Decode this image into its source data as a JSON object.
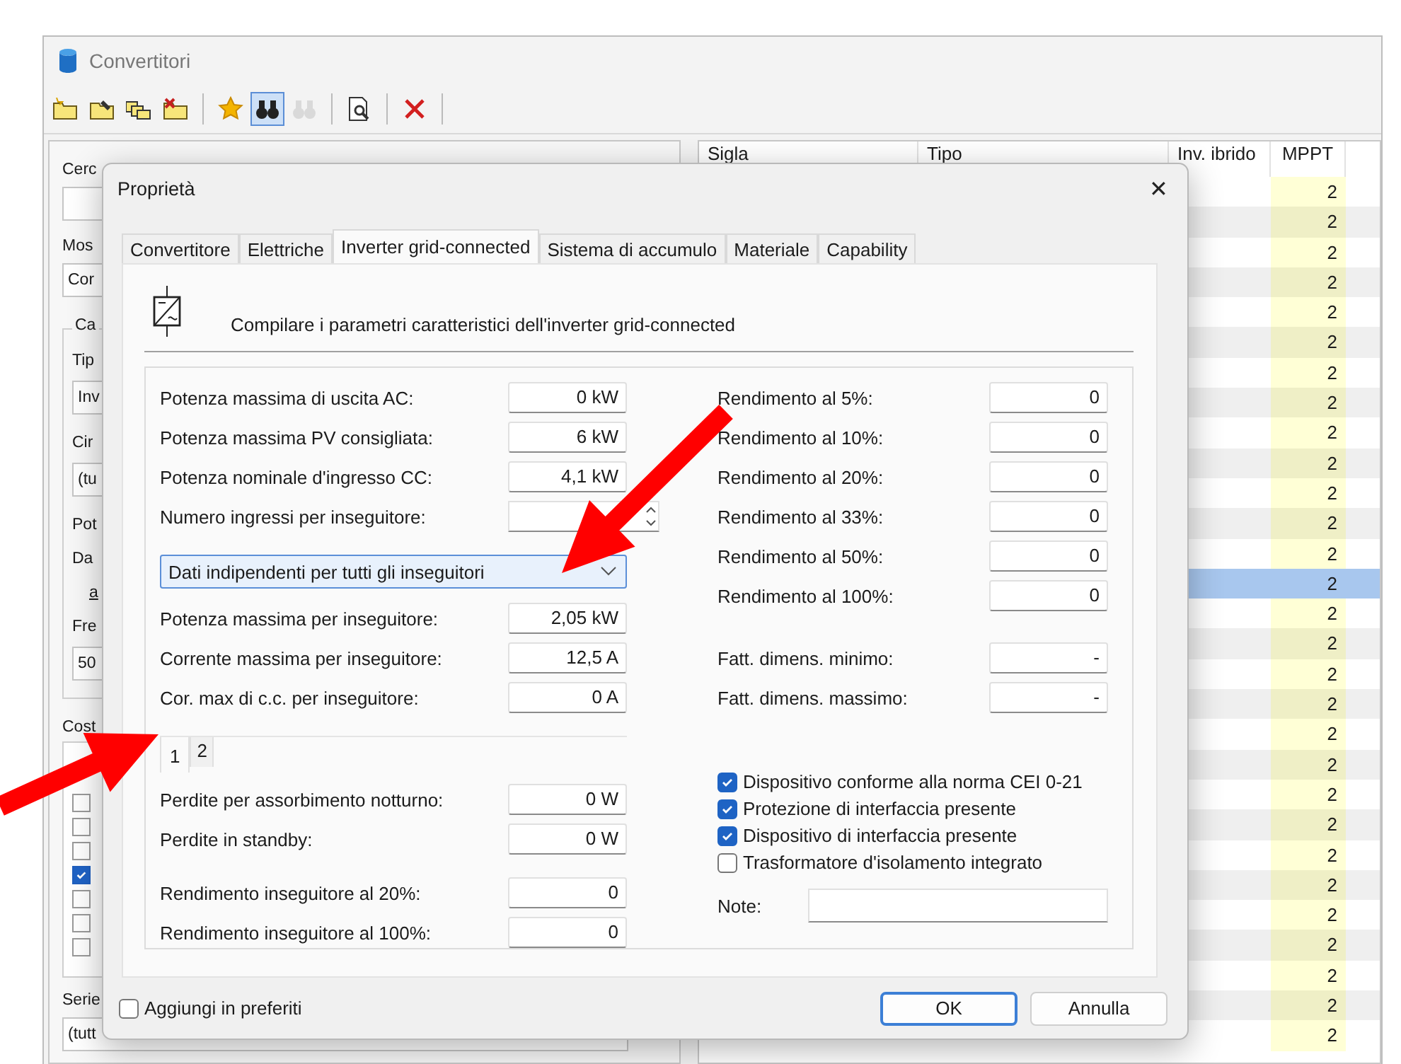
{
  "window": {
    "title": "Convertitori"
  },
  "toolbar": [
    {
      "selected": false,
      "disabled": false
    },
    {
      "selected": false,
      "disabled": false
    },
    {
      "selected": false,
      "disabled": false
    },
    {
      "selected": false,
      "disabled": false
    },
    {
      "selected": false,
      "disabled": false
    },
    {
      "selected": true,
      "disabled": false
    },
    {
      "selected": false,
      "disabled": true
    },
    {
      "selected": false,
      "disabled": false
    },
    {
      "selected": false,
      "disabled": false
    }
  ],
  "filter_panel": {
    "search_label": "Cerc",
    "show_label": "Mos",
    "show_value": "Cor",
    "group": {
      "legend": "Ca",
      "items": [
        {
          "kind": "label",
          "text": "Tip"
        },
        {
          "kind": "field",
          "value": "Inv"
        },
        {
          "kind": "label",
          "text": "Cir"
        },
        {
          "kind": "field",
          "value": "(tu"
        },
        {
          "kind": "label",
          "text": "Pot"
        },
        {
          "kind": "label",
          "text": "Da"
        },
        {
          "kind": "link",
          "text": "a"
        },
        {
          "kind": "label",
          "text": "Fre"
        },
        {
          "kind": "field",
          "value": "50"
        }
      ]
    },
    "cost_label": "Cost",
    "checklist": [
      {
        "checked": false
      },
      {
        "checked": false
      },
      {
        "checked": false
      },
      {
        "checked": true
      },
      {
        "checked": false
      },
      {
        "checked": false
      },
      {
        "checked": false
      }
    ],
    "series_label": "Serie",
    "series_value": "(tutt"
  },
  "table": {
    "columns": [
      "Sigla",
      "Tipo",
      "Inv. ibrido",
      "MPPT"
    ],
    "rows": [
      {
        "mppt": "2",
        "selected": false
      },
      {
        "mppt": "2",
        "selected": false
      },
      {
        "mppt": "2",
        "selected": false
      },
      {
        "mppt": "2",
        "selected": false
      },
      {
        "mppt": "2",
        "selected": false
      },
      {
        "mppt": "2",
        "selected": false
      },
      {
        "mppt": "2",
        "selected": false
      },
      {
        "mppt": "2",
        "selected": false
      },
      {
        "mppt": "2",
        "selected": false
      },
      {
        "mppt": "2",
        "selected": false
      },
      {
        "mppt": "2",
        "selected": false
      },
      {
        "mppt": "2",
        "selected": false
      },
      {
        "mppt": "2",
        "selected": false
      },
      {
        "mppt": "2",
        "selected": true
      },
      {
        "mppt": "2",
        "selected": false
      },
      {
        "mppt": "2",
        "selected": false
      },
      {
        "mppt": "2",
        "selected": false
      },
      {
        "mppt": "2",
        "selected": false
      },
      {
        "mppt": "2",
        "selected": false
      },
      {
        "mppt": "2",
        "selected": false
      },
      {
        "mppt": "2",
        "selected": false
      },
      {
        "mppt": "2",
        "selected": false
      },
      {
        "mppt": "2",
        "selected": false
      },
      {
        "mppt": "2",
        "selected": false
      },
      {
        "mppt": "2",
        "selected": false
      },
      {
        "mppt": "2",
        "selected": false
      },
      {
        "mppt": "2",
        "selected": false
      },
      {
        "mppt": "2",
        "selected": false
      },
      {
        "mppt": "2",
        "selected": false
      }
    ]
  },
  "dialog": {
    "title": "Proprietà",
    "close": "✕",
    "tabs": [
      {
        "label": "Convertitore",
        "selected": false
      },
      {
        "label": "Elettriche",
        "selected": false
      },
      {
        "label": "Inverter grid-connected",
        "selected": true
      },
      {
        "label": "Sistema di accumulo",
        "selected": false
      },
      {
        "label": "Materiale",
        "selected": false
      },
      {
        "label": "Capability",
        "selected": false
      }
    ],
    "header": "Compilare i parametri caratteristici dell'inverter grid-connected",
    "main_fields": [
      {
        "kind": "text",
        "label": "Potenza massima di uscita AC:",
        "value": "0 kW"
      },
      {
        "kind": "text",
        "label": "Potenza massima PV consigliata:",
        "value": "6 kW"
      },
      {
        "kind": "text",
        "label": "Potenza nominale d'ingresso CC:",
        "value": "4,1 kW"
      },
      {
        "kind": "spin",
        "label": "Numero ingressi per inseguitore:"
      }
    ],
    "mode_select": {
      "value": "Dati indipendenti per tutti gli inseguitori"
    },
    "tracker_fields": [
      {
        "label": "Potenza massima per inseguitore:",
        "value": "2,05 kW"
      },
      {
        "label": "Corrente massima per inseguitore:",
        "value": "12,5 A"
      },
      {
        "label": "Cor. max di c.c. per inseguitore:",
        "value": "0 A"
      }
    ],
    "tracker_tabs": [
      {
        "label": "1",
        "selected": true
      },
      {
        "label": "2",
        "selected": false
      }
    ],
    "loss_fields": [
      {
        "label": "Perdite per assorbimento notturno:",
        "value": "0 W"
      },
      {
        "label": "Perdite in standby:",
        "value": "0 W"
      }
    ],
    "tracker_efficiency": [
      {
        "label": "Rendimento inseguitore al 20%:",
        "value": "0"
      },
      {
        "label": "Rendimento inseguitore al 100%:",
        "value": "0"
      }
    ],
    "efficiency_fields": [
      {
        "label": "Rendimento al 5%:",
        "value": "0"
      },
      {
        "label": "Rendimento al 10%:",
        "value": "0"
      },
      {
        "label": "Rendimento al 20%:",
        "value": "0"
      },
      {
        "label": "Rendimento al 33%:",
        "value": "0"
      },
      {
        "label": "Rendimento al 50%:",
        "value": "0"
      },
      {
        "label": "Rendimento al 100%:",
        "value": "0"
      }
    ],
    "sizing_fields": [
      {
        "label": "Fatt. dimens. minimo:",
        "value": "-"
      },
      {
        "label": "Fatt. dimens. massimo:",
        "value": "-"
      }
    ],
    "options": [
      {
        "label": "Dispositivo conforme alla norma CEI 0-21",
        "checked": true
      },
      {
        "label": "Protezione di interfaccia presente",
        "checked": true
      },
      {
        "label": "Dispositivo di interfaccia presente",
        "checked": true
      },
      {
        "label": "Trasformatore d'isolamento integrato",
        "checked": false
      }
    ],
    "note": {
      "label": "Note:"
    },
    "favorite": {
      "label": "Aggiungi in preferiti",
      "checked": false
    },
    "buttons": [
      {
        "label": "OK",
        "default": true
      },
      {
        "label": "Annulla",
        "default": false
      }
    ]
  }
}
